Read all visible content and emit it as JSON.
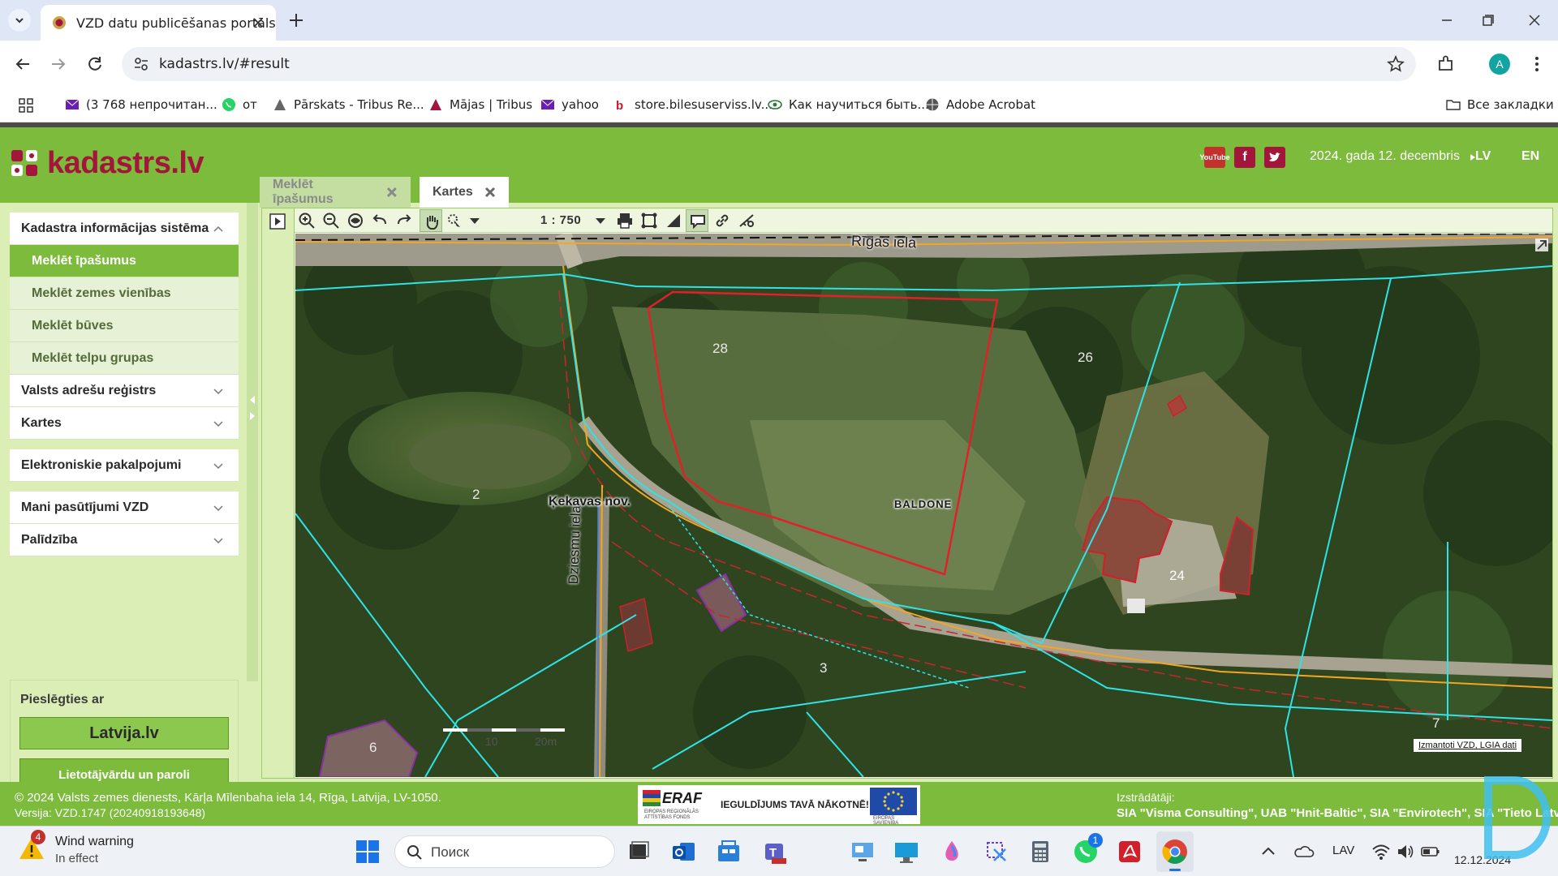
{
  "browser": {
    "tab_title": "VZD datu publicēšanas portāls",
    "url": "kadastrs.lv/#result",
    "bookmarks": [
      {
        "label": "(3 768 непрочитан...",
        "icon": "mail-icon"
      },
      {
        "label": "от",
        "icon": "whatsapp-icon"
      },
      {
        "label": "Pārskats - Tribus Re...",
        "icon": "tribus-icon"
      },
      {
        "label": "Mājas | Tribus",
        "icon": "tribus-icon"
      },
      {
        "label": "yahoo",
        "icon": "mail-icon"
      },
      {
        "label": "store.bilesuserviss.lv...",
        "icon": "bilesu-icon"
      },
      {
        "label": "Как научиться быть...",
        "icon": "eye-icon"
      },
      {
        "label": "Adobe Acrobat",
        "icon": "globe-icon"
      }
    ],
    "all_bookmarks": "Все закладки",
    "profile_initial": "A"
  },
  "header": {
    "logo_text": "kadastrs.lv",
    "date": "2024. gada 12. decembris",
    "lang_lv": "LV",
    "lang_en": "EN",
    "social": [
      "YouTube",
      "f",
      "twitter"
    ]
  },
  "tabs": [
    {
      "label": "Meklēt īpašumus"
    },
    {
      "label": "Kartes"
    }
  ],
  "sidebar": {
    "sections": [
      {
        "label": "Kadastra informācijas sistēma"
      },
      {
        "label": "Valsts adrešu reģistrs"
      },
      {
        "label": "Kartes"
      },
      {
        "label": "Elektroniskie pakalpojumi"
      },
      {
        "label": "Mani pasūtījumi VZD"
      },
      {
        "label": "Palīdzība"
      }
    ],
    "subitems": [
      {
        "label": "Meklēt īpašumus"
      },
      {
        "label": "Meklēt zemes vienības"
      },
      {
        "label": "Meklēt būves"
      },
      {
        "label": "Meklēt telpu grupas"
      }
    ],
    "login": {
      "title": "Pieslēgties ar",
      "latvija": "Latvija.lv",
      "userpass": "Lietotājvārdu un paroli"
    }
  },
  "map": {
    "scale": "1 : 750",
    "street_labels": [
      "Rīgas iela",
      "Dziesmu iela"
    ],
    "region_labels": [
      "Ķekavas nov.",
      "BALDONE"
    ],
    "parcel_numbers": [
      "28",
      "26",
      "2",
      "24",
      "3",
      "6",
      "7"
    ],
    "scalebar_labels": [
      "10",
      "20m"
    ],
    "attribution": "Izmantoti VZD, LGIA dati"
  },
  "footer": {
    "copyright": "© 2024 Valsts zemes dienests, Kārļa Mīlenbaha iela 14, Rīga, Latvija, LV-1050.",
    "version": "Versija: VZD.1747 (20240918193648)",
    "eraf_name": "ERAF",
    "eraf_sub": "EIROPAS REĢIONĀLĀS ATTĪSTĪBAS FONDS",
    "eraf_slogan": "IEGULDĪJUMS TAVĀ NĀKOTNĒ!",
    "eu_sub": "EIROPAS SAVIENĪBA",
    "developers_title": "Izstrādātāji:",
    "developers": "SIA \"Visma Consulting\", UAB \"Hnit-Baltic\", SIA \"Envirotech\", SIA \"Tieto Latvia"
  },
  "taskbar": {
    "weather_title": "Wind warning",
    "weather_sub": "In effect",
    "weather_badge": "4",
    "search_placeholder": "Поиск",
    "whatsapp_badge": "1",
    "lang": "LAV",
    "date": "12.12.2024"
  }
}
